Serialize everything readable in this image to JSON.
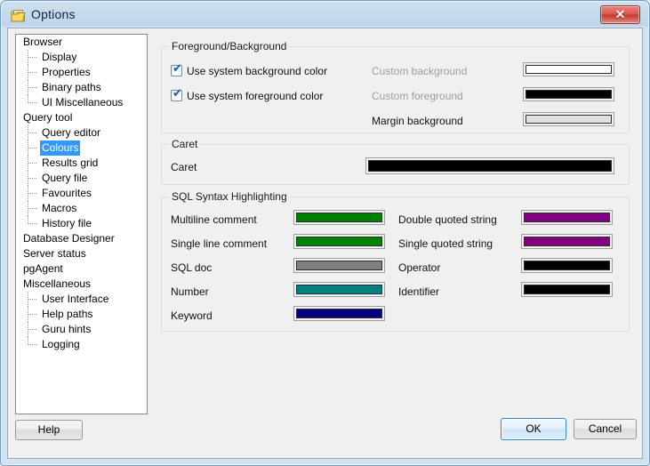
{
  "window": {
    "title": "Options",
    "icon": "options-document-icon",
    "close_label": "✕"
  },
  "tree": {
    "items": [
      {
        "label": "Browser",
        "level": 0,
        "selected": false
      },
      {
        "label": "Display",
        "level": 1,
        "selected": false
      },
      {
        "label": "Properties",
        "level": 1,
        "selected": false
      },
      {
        "label": "Binary paths",
        "level": 1,
        "selected": false
      },
      {
        "label": "UI Miscellaneous",
        "level": 1,
        "selected": false,
        "last": true
      },
      {
        "label": "Query tool",
        "level": 0,
        "selected": false
      },
      {
        "label": "Query editor",
        "level": 1,
        "selected": false
      },
      {
        "label": "Colours",
        "level": 1,
        "selected": true
      },
      {
        "label": "Results grid",
        "level": 1,
        "selected": false
      },
      {
        "label": "Query file",
        "level": 1,
        "selected": false
      },
      {
        "label": "Favourites",
        "level": 1,
        "selected": false
      },
      {
        "label": "Macros",
        "level": 1,
        "selected": false
      },
      {
        "label": "History file",
        "level": 1,
        "selected": false,
        "last": true
      },
      {
        "label": "Database Designer",
        "level": 0,
        "selected": false
      },
      {
        "label": "Server status",
        "level": 0,
        "selected": false
      },
      {
        "label": "pgAgent",
        "level": 0,
        "selected": false
      },
      {
        "label": "Miscellaneous",
        "level": 0,
        "selected": false
      },
      {
        "label": "User Interface",
        "level": 1,
        "selected": false
      },
      {
        "label": "Help paths",
        "level": 1,
        "selected": false
      },
      {
        "label": "Guru hints",
        "level": 1,
        "selected": false
      },
      {
        "label": "Logging",
        "level": 1,
        "selected": false,
        "last": true
      }
    ]
  },
  "foreground_background": {
    "title": "Foreground/Background",
    "checkboxes": [
      {
        "label": "Use system background color",
        "checked": true
      },
      {
        "label": "Use system foreground color",
        "checked": true
      }
    ],
    "rows": [
      {
        "label": "Custom background",
        "disabled": true,
        "color": "#ffffff"
      },
      {
        "label": "Custom foreground",
        "disabled": true,
        "color": "#000000"
      },
      {
        "label": "Margin background",
        "disabled": false,
        "color": "#e0e0e0"
      }
    ]
  },
  "caret": {
    "title": "Caret",
    "label": "Caret",
    "color": "#000000"
  },
  "sql_syntax": {
    "title": "SQL Syntax Highlighting",
    "left_column": [
      {
        "label": "Multiline comment",
        "color": "#008000"
      },
      {
        "label": "Single line comment",
        "color": "#008000"
      },
      {
        "label": "SQL doc",
        "color": "#808080"
      },
      {
        "label": "Number",
        "color": "#008080"
      },
      {
        "label": "Keyword",
        "color": "#000080"
      }
    ],
    "right_column": [
      {
        "label": "Double quoted string",
        "color": "#800080"
      },
      {
        "label": "Single quoted string",
        "color": "#800080"
      },
      {
        "label": "Operator",
        "color": "#000000"
      },
      {
        "label": "Identifier",
        "color": "#000000"
      }
    ]
  },
  "buttons": {
    "help": "Help",
    "ok": "OK",
    "cancel": "Cancel"
  }
}
